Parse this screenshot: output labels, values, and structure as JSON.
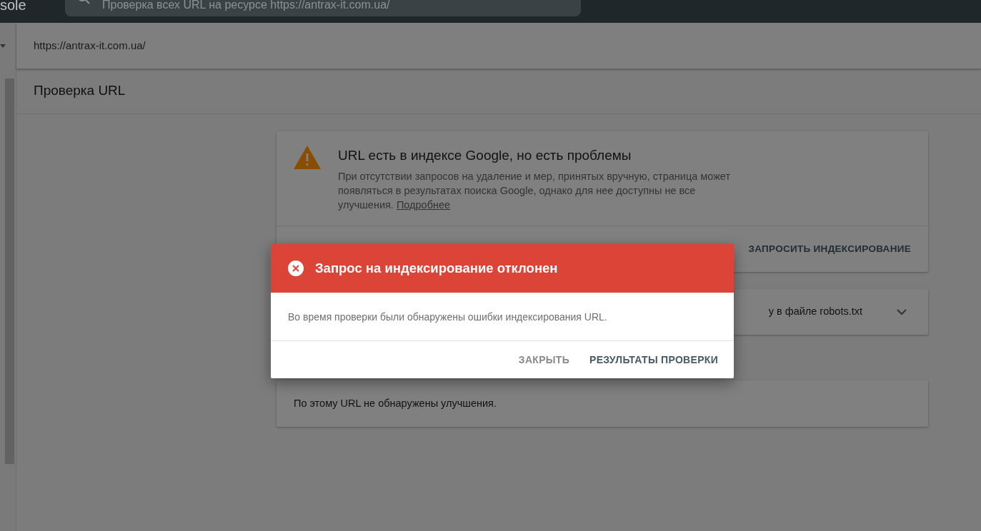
{
  "header": {
    "logo": "sole",
    "search": {
      "placeholder": "Проверка всех URL на ресурсе https://antrax-it.com.ua/"
    }
  },
  "property": {
    "url": "https://antrax-it.com.ua/"
  },
  "page_title": "Проверка URL",
  "status_card": {
    "kind": "warning",
    "title": "URL есть в индексе Google, но есть проблемы",
    "description": "При отсутствии запросов на удаление и мер, принятых вручную, страница может появляться в результатах поиска Google, однако для нее доступны не все улучшения.",
    "link": "Подробнее",
    "action": "ЗАПРОСИТЬ ИНДЕКСИРОВАНИЕ"
  },
  "coverage_card": {
    "text": "у в файле robots.txt",
    "expanded": false
  },
  "enhancements_card": {
    "text": "По этому URL не обнаружены улучшения."
  },
  "dialog": {
    "kind": "error",
    "title": "Запрос на индексирование отклонен",
    "message": "Во время проверки были обнаружены ошибки индексирования URL.",
    "buttons": [
      {
        "label": "ЗАКРЫТЬ",
        "kind": "secondary"
      },
      {
        "label": "РЕЗУЛЬТАТЫ ПРОВЕРКИ",
        "kind": "primary"
      }
    ]
  }
}
